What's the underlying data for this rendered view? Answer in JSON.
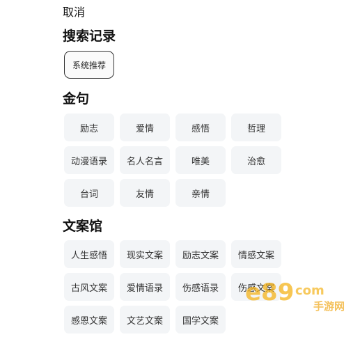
{
  "cancel_label": "取消",
  "history": {
    "title": "搜索记录",
    "items": [
      "系统推荐"
    ]
  },
  "quotes": {
    "title": "金句",
    "tags": [
      "励志",
      "爱情",
      "感悟",
      "哲理",
      "动漫语录",
      "名人名言",
      "唯美",
      "治愈",
      "台词",
      "友情",
      "亲情"
    ]
  },
  "copywriting": {
    "title": "文案馆",
    "tags": [
      "人生感悟",
      "现实文案",
      "励志文案",
      "情感文案",
      "古风文案",
      "爱情语录",
      "伤感语录",
      "伤感文案",
      "感恩文案",
      "文艺文案",
      "国学文案"
    ]
  },
  "watermark": {
    "brand": "e89",
    "suffix": "com",
    "subtitle": "手游网"
  }
}
